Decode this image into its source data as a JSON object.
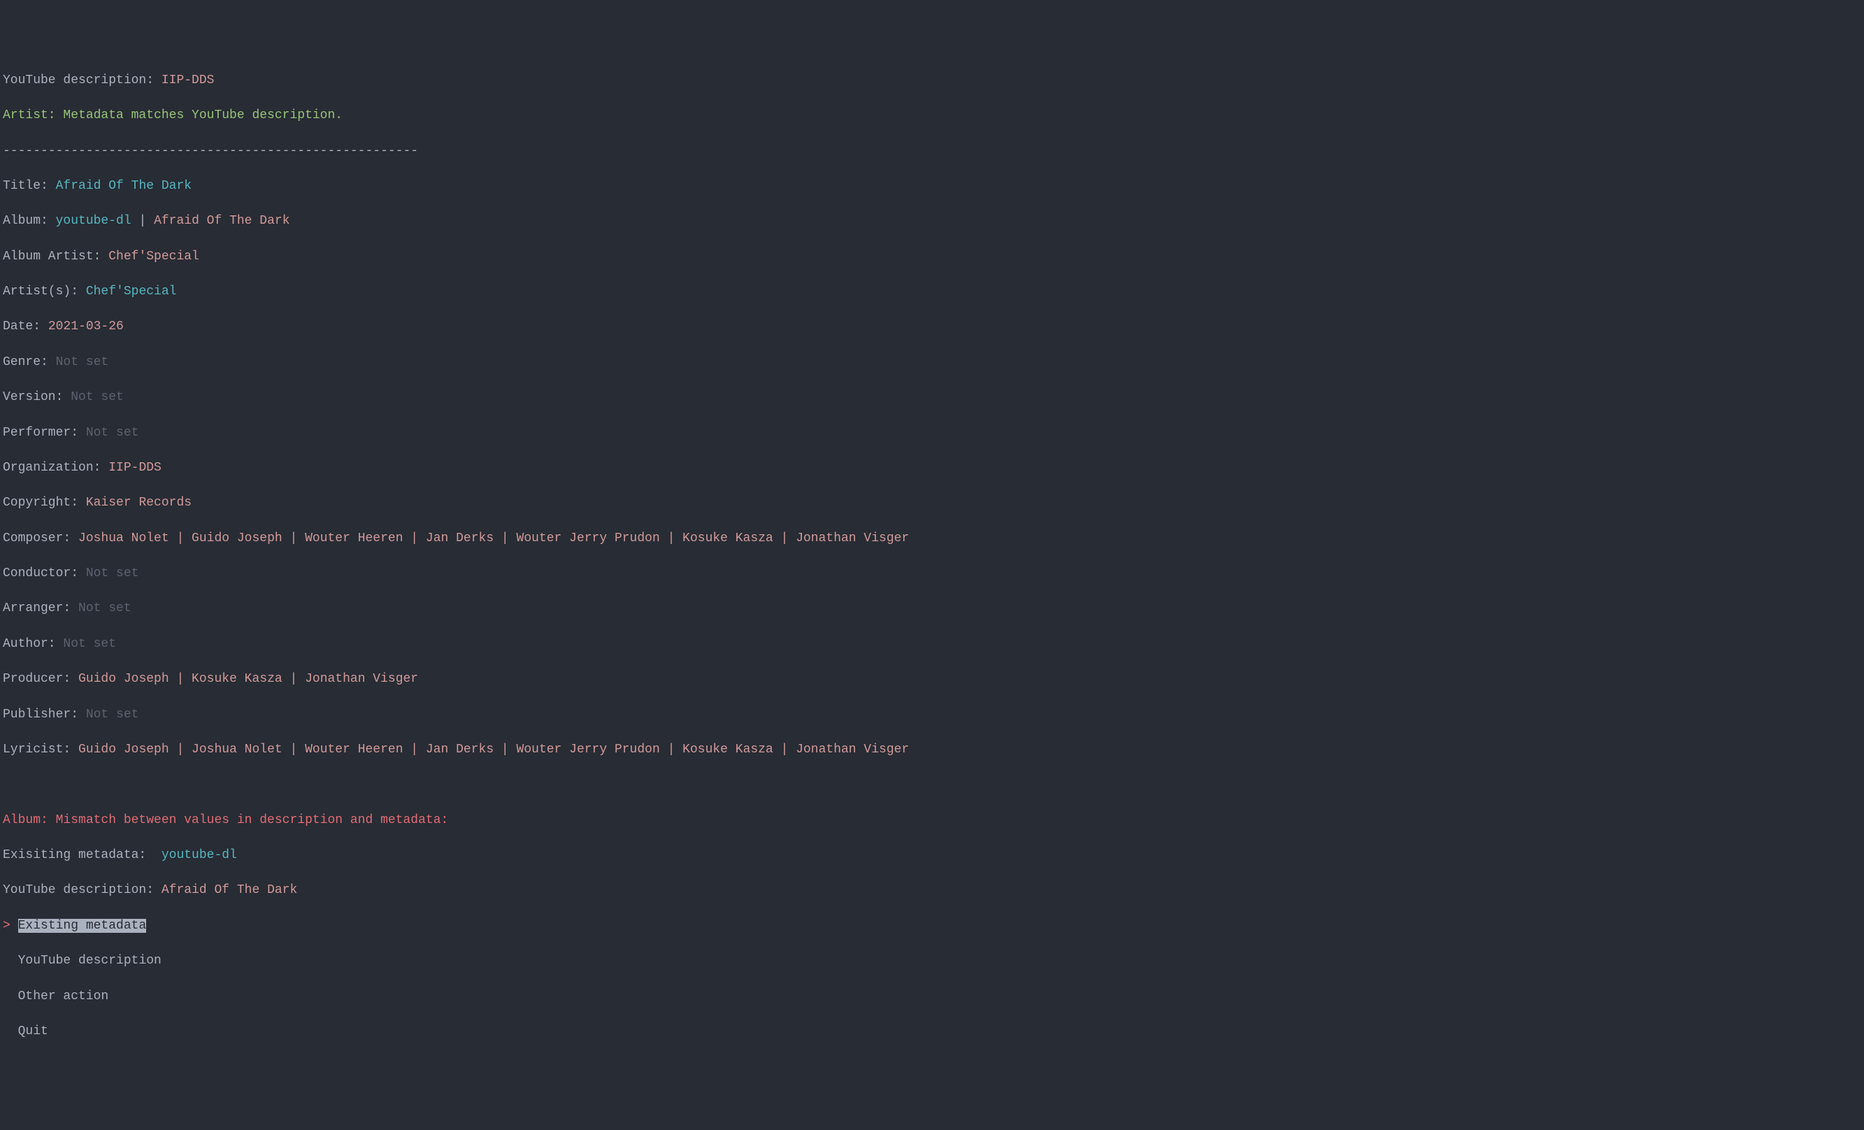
{
  "top": {
    "ytdesc_label": "YouTube description: ",
    "ytdesc_value": "IIP-DDS",
    "artist_match": "Artist: Metadata matches YouTube description.",
    "divider": "-------------------------------------------------------"
  },
  "meta": {
    "title_label": "Title: ",
    "title_value": "Afraid Of The Dark",
    "album_label": "Album: ",
    "album_val1": "youtube-dl",
    "album_sep": " | ",
    "album_val2": "Afraid Of The Dark",
    "album_artist_label": "Album Artist: ",
    "album_artist_value": "Chef'Special",
    "artists_label": "Artist(s): ",
    "artists_value": "Chef'Special",
    "date_label": "Date: ",
    "date_value": "2021-03-26",
    "genre_label": "Genre: ",
    "version_label": "Version: ",
    "performer_label": "Performer: ",
    "organization_label": "Organization: ",
    "organization_value": "IIP-DDS",
    "copyright_label": "Copyright: ",
    "copyright_value": "Kaiser Records",
    "composer_label": "Composer: ",
    "composer_value": "Joshua Nolet | Guido Joseph | Wouter Heeren | Jan Derks | Wouter Jerry Prudon | Kosuke Kasza | Jonathan Visger",
    "conductor_label": "Conductor: ",
    "arranger_label": "Arranger: ",
    "author_label": "Author: ",
    "producer_label": "Producer: ",
    "producer_value": "Guido Joseph | Kosuke Kasza | Jonathan Visger",
    "publisher_label": "Publisher: ",
    "lyricist_label": "Lyricist: ",
    "lyricist_value": "Guido Joseph | Joshua Nolet | Wouter Heeren | Jan Derks | Wouter Jerry Prudon | Kosuke Kasza | Jonathan Visger",
    "not_set": "Not set"
  },
  "mismatch": {
    "header": "Album: Mismatch between values in description and metadata:",
    "existing_label": "Exisiting metadata:  ",
    "existing_value": "youtube-dl",
    "ytdesc_label": "YouTube description: ",
    "ytdesc_value": "Afraid Of The Dark"
  },
  "menu": {
    "cursor": "> ",
    "indent": "  ",
    "items": [
      "Existing metadata",
      "YouTube description",
      "Other action",
      "Quit"
    ]
  }
}
